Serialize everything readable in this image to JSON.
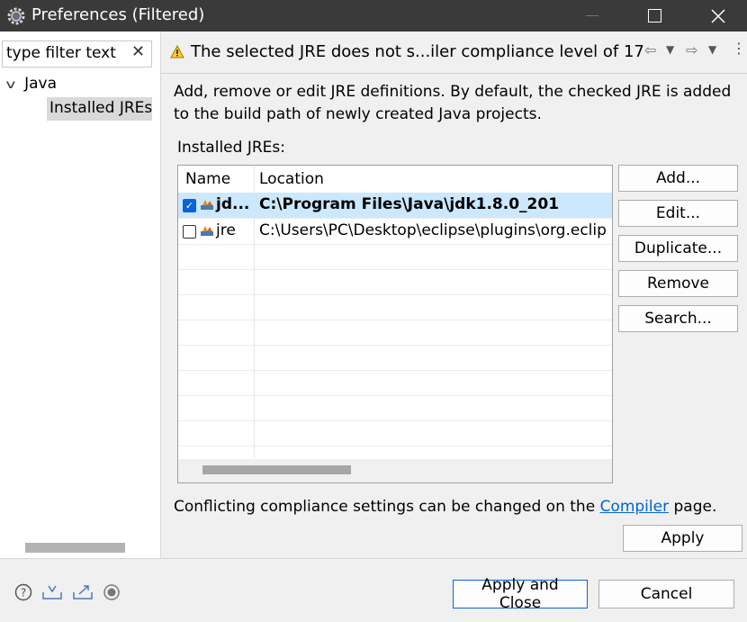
{
  "window": {
    "title": "Preferences (Filtered)"
  },
  "filter": {
    "value": "type filter text"
  },
  "tree": {
    "java_label": "Java",
    "installed_jres_label": "Installed JREs"
  },
  "message": {
    "warning_text": "The selected JRE does not s...iler compliance level of 17"
  },
  "description": "Add, remove or edit JRE definitions. By default, the checked JRE is added to the build path of newly created Java projects.",
  "installed_jres_label": "Installed JREs:",
  "table": {
    "headers": [
      "Name",
      "Location"
    ],
    "rows": [
      {
        "name": "jd...",
        "location": "C:\\Program Files\\Java\\jdk1.8.0_201",
        "checked": true,
        "selected": true
      },
      {
        "name": "jre",
        "location": "C:\\Users\\PC\\Desktop\\eclipse\\plugins\\org.eclip",
        "checked": false,
        "selected": false
      }
    ]
  },
  "buttons": {
    "add": "Add...",
    "edit": "Edit...",
    "duplicate": "Duplicate...",
    "remove": "Remove",
    "search": "Search...",
    "apply": "Apply",
    "apply_and_close": "Apply and Close",
    "cancel": "Cancel"
  },
  "conflict": {
    "before": "Conflicting compliance settings can be changed on the ",
    "link": "Compiler",
    "after": " page."
  },
  "colors": {
    "titlebar": "#3a3a3a",
    "selection": "#cce8ff",
    "link": "#0066cc",
    "checkbox": "#0a64d8"
  }
}
